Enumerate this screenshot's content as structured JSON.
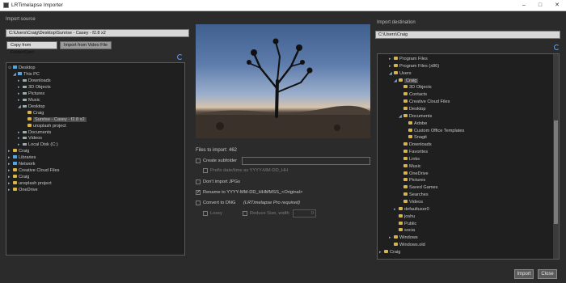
{
  "window": {
    "title": "LRTimelapse Importer",
    "buttons": {
      "minimize": "–",
      "maximize": "□",
      "close": "✕"
    }
  },
  "import_source": {
    "label": "Import source",
    "path": "C:\\Users\\Craig\\Desktop\\Sunrise - Casey - f2.8 x2",
    "tabs": [
      "Copy from Folder/Card",
      "Import from Video File"
    ],
    "tree": [
      {
        "label": "Desktop",
        "indent": 0,
        "icon": "pc",
        "twisty": "⊙"
      },
      {
        "label": "This PC",
        "indent": 1,
        "icon": "pc",
        "twisty": "◢"
      },
      {
        "label": "Downloads",
        "indent": 2,
        "icon": "drive",
        "twisty": "▸"
      },
      {
        "label": "3D Objects",
        "indent": 2,
        "icon": "drive",
        "twisty": "▸"
      },
      {
        "label": "Pictures",
        "indent": 2,
        "icon": "drive",
        "twisty": "▸"
      },
      {
        "label": "Music",
        "indent": 2,
        "icon": "drive",
        "twisty": "▸"
      },
      {
        "label": "Desktop",
        "indent": 2,
        "icon": "drive",
        "twisty": "◢"
      },
      {
        "label": "Craig",
        "indent": 3,
        "icon": "folder",
        "twisty": ""
      },
      {
        "label": "Sunrise - Casey - f2.8 x2",
        "indent": 3,
        "icon": "folder",
        "twisty": "",
        "selected": true
      },
      {
        "label": "unsplash project",
        "indent": 3,
        "icon": "folder",
        "twisty": ""
      },
      {
        "label": "Documents",
        "indent": 2,
        "icon": "drive",
        "twisty": "▸"
      },
      {
        "label": "Videos",
        "indent": 2,
        "icon": "drive",
        "twisty": "▸"
      },
      {
        "label": "Local Disk (C:)",
        "indent": 2,
        "icon": "drive",
        "twisty": "▸"
      },
      {
        "label": "Craig",
        "indent": 0,
        "icon": "folder",
        "twisty": "▸"
      },
      {
        "label": "Libraries",
        "indent": 0,
        "icon": "pc",
        "twisty": "▸"
      },
      {
        "label": "Network",
        "indent": 0,
        "icon": "pc",
        "twisty": "▸"
      },
      {
        "label": "Creative Cloud Files",
        "indent": 0,
        "icon": "folder",
        "twisty": "▸"
      },
      {
        "label": "Craig",
        "indent": 0,
        "icon": "folder",
        "twisty": "▸"
      },
      {
        "label": "unsplash project",
        "indent": 0,
        "icon": "folder",
        "twisty": "▸"
      },
      {
        "label": "OneDrive",
        "indent": 0,
        "icon": "folder",
        "twisty": "▸"
      }
    ]
  },
  "center": {
    "files_to_import": "Files to import: 462",
    "options": [
      {
        "label": "Create subfolder",
        "checked": false,
        "dim": false
      },
      {
        "label": "Prefix date/time as YYYY-MM-DD_HH",
        "checked": false,
        "dim": true
      },
      {
        "label": "Don't import JPGs",
        "checked": false,
        "dim": false
      },
      {
        "label": "Rename to YYYY-MM-DD_HHMMSS_<Original>",
        "checked": true,
        "dim": false
      },
      {
        "label": "Convert to DNG",
        "checked": false,
        "dim": false,
        "note": "(LRTimelapse Pro required)"
      },
      {
        "label": "Lossy",
        "checked": false,
        "dim": true
      },
      {
        "label": "Reduce Size, width",
        "checked": false,
        "dim": true
      }
    ],
    "reduce_value": "0"
  },
  "import_destination": {
    "label": "Import destination",
    "path": "C:\\Users\\Craig",
    "tree": [
      {
        "label": "Program Files",
        "indent": 2,
        "twisty": "▸"
      },
      {
        "label": "Program Files (x86)",
        "indent": 2,
        "twisty": "▸"
      },
      {
        "label": "Users",
        "indent": 2,
        "twisty": "◢"
      },
      {
        "label": "Craig",
        "indent": 3,
        "twisty": "◢",
        "selected": true
      },
      {
        "label": "3D Objects",
        "indent": 4,
        "twisty": ""
      },
      {
        "label": "Contacts",
        "indent": 4,
        "twisty": ""
      },
      {
        "label": "Creative Cloud Files",
        "indent": 4,
        "twisty": ""
      },
      {
        "label": "Desktop",
        "indent": 4,
        "twisty": ""
      },
      {
        "label": "Documents",
        "indent": 4,
        "twisty": "◢"
      },
      {
        "label": "Adobe",
        "indent": 5,
        "twisty": ""
      },
      {
        "label": "Custom Office Templates",
        "indent": 5,
        "twisty": ""
      },
      {
        "label": "Snagit",
        "indent": 5,
        "twisty": ""
      },
      {
        "label": "Downloads",
        "indent": 4,
        "twisty": ""
      },
      {
        "label": "Favorites",
        "indent": 4,
        "twisty": ""
      },
      {
        "label": "Links",
        "indent": 4,
        "twisty": ""
      },
      {
        "label": "Music",
        "indent": 4,
        "twisty": ""
      },
      {
        "label": "OneDrive",
        "indent": 4,
        "twisty": ""
      },
      {
        "label": "Pictures",
        "indent": 4,
        "twisty": ""
      },
      {
        "label": "Saved Games",
        "indent": 4,
        "twisty": ""
      },
      {
        "label": "Searches",
        "indent": 4,
        "twisty": ""
      },
      {
        "label": "Videos",
        "indent": 4,
        "twisty": ""
      },
      {
        "label": "defaultuser0",
        "indent": 3,
        "twisty": "▸"
      },
      {
        "label": "joshu",
        "indent": 3,
        "twisty": ""
      },
      {
        "label": "Public",
        "indent": 3,
        "twisty": ""
      },
      {
        "label": "socia",
        "indent": 3,
        "twisty": ""
      },
      {
        "label": "Windows",
        "indent": 2,
        "twisty": "▸"
      },
      {
        "label": "Windows.old",
        "indent": 2,
        "twisty": ""
      },
      {
        "label": "Craig",
        "indent": 0,
        "twisty": "▸"
      }
    ]
  },
  "footer": {
    "buttons": [
      "Import",
      "Close"
    ]
  }
}
